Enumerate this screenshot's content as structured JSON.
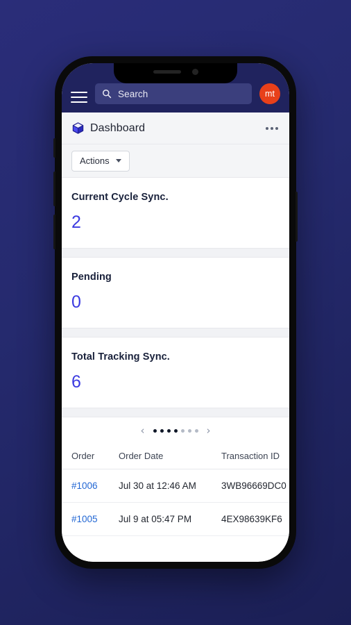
{
  "topbar": {
    "menu_icon": "hamburger-icon",
    "search": {
      "icon": "search-icon",
      "placeholder": "Search",
      "value": ""
    },
    "avatar_initials": "mt",
    "avatar_color": "#e8401a",
    "background_color": "#20235e"
  },
  "page_header": {
    "icon": "cube-icon",
    "title": "Dashboard",
    "overflow_icon": "ellipsis-horizontal-icon"
  },
  "toolbar": {
    "actions_label": "Actions",
    "actions_caret_icon": "chevron-down-icon"
  },
  "metrics": [
    {
      "label": "Current Cycle Sync.",
      "value": "2"
    },
    {
      "label": "Pending",
      "value": "0"
    },
    {
      "label": "Total Tracking Sync.",
      "value": "6"
    }
  ],
  "carousel": {
    "prev_icon": "chevron-left-icon",
    "next_icon": "chevron-right-icon",
    "prev_glyph": "‹",
    "next_glyph": "›",
    "total_dots": 7,
    "active_dots": 4
  },
  "orders_table": {
    "columns": [
      "Order",
      "Order Date",
      "Transaction ID"
    ],
    "rows": [
      {
        "order": "#1006",
        "order_date": "Jul 30 at 12:46 AM",
        "transaction_id": "3WB96669DC0"
      },
      {
        "order": "#1005",
        "order_date": "Jul 9 at 05:47 PM",
        "transaction_id": "4EX98639KF6"
      }
    ]
  },
  "theme": {
    "accent_blue": "#3b3ae0",
    "link_blue": "#2267d4",
    "navy": "#20235e",
    "page_bg": "#f4f5f7",
    "desktop_bg": "#252a6e"
  }
}
